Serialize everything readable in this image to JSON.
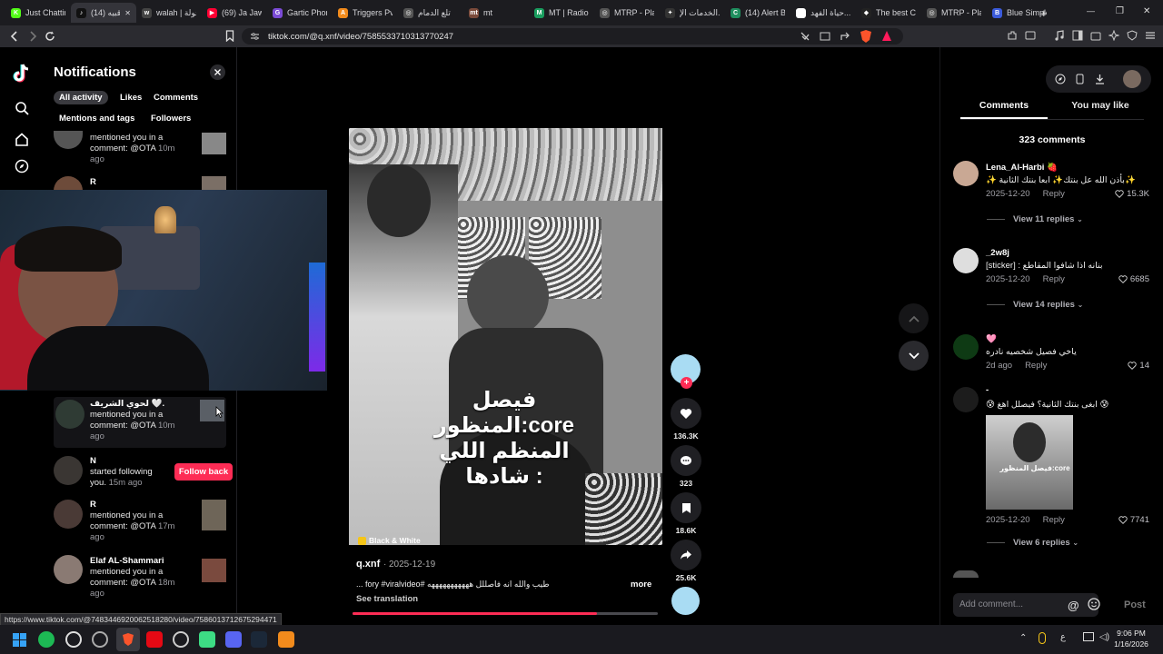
{
  "browser": {
    "tabs": [
      {
        "label": "Just Chattin",
        "favicon": "K",
        "color": "#53fc18"
      },
      {
        "label": "(14) قبيه",
        "favicon": "♪",
        "color": "#111111",
        "active": true
      },
      {
        "label": "walah | جولة",
        "favicon": "w",
        "color": "#444444"
      },
      {
        "label": "(69) Ja Jaw...",
        "favicon": "▶",
        "color": "#ff0033"
      },
      {
        "label": "Gartic Phon...",
        "favicon": "G",
        "color": "#7b4bd6"
      },
      {
        "label": "Triggers Pv...",
        "favicon": "A",
        "color": "#f28b1c"
      },
      {
        "label": "تلع الدمام",
        "favicon": "◎",
        "color": "#555555"
      },
      {
        "label": "mt",
        "favicon": "mt",
        "color": "#7a4a3a"
      },
      {
        "label": "MT | Radio",
        "favicon": "M",
        "color": "#1a9e5f"
      },
      {
        "label": "MTRP - Pla...",
        "favicon": "◎",
        "color": "#555555"
      },
      {
        "label": "الخدمات الإ...",
        "favicon": "✦",
        "color": "#333333"
      },
      {
        "label": "(14) Alert B...",
        "favicon": "C",
        "color": "#1f8f5f"
      },
      {
        "label": "حياة الفهد...",
        "favicon": "G",
        "color": "#ffffff"
      },
      {
        "label": "The best Cl...",
        "favicon": "◆",
        "color": "#222222"
      },
      {
        "label": "MTRP - Pla...",
        "favicon": "◎",
        "color": "#555555"
      },
      {
        "label": "Blue Simple...",
        "favicon": "B",
        "color": "#3b5bdb"
      }
    ],
    "url": "tiktok.com/@q.xnf/video/7585533710313770247",
    "status_url": "https://www.tiktok.com/@7483446920062518280/video/7586013712675294471"
  },
  "notifications": {
    "title": "Notifications",
    "filters": [
      "All activity",
      "Likes",
      "Comments",
      "Mentions and tags",
      "Followers"
    ],
    "items": [
      {
        "name": "",
        "line1": "mentioned you in a",
        "line2": "comment: @OTA",
        "time": "10m",
        "time2": "ago"
      },
      {
        "name": "R",
        "line1": "",
        "line2": "",
        "time": "",
        "time2": ""
      },
      {
        "name": "لحوي الشريف 🤍.",
        "line1": "mentioned you in a",
        "line2": "comment: @OTA",
        "time": "10m",
        "time2": "ago"
      },
      {
        "name": "N",
        "line1": "started following",
        "line2": "you.",
        "time": "15m ago",
        "time2": ""
      },
      {
        "name": "R",
        "line1": "mentioned you in a",
        "line2": "comment: @OTA",
        "time": "17m",
        "time2": "ago"
      },
      {
        "name": "Elaf AL-Shammari",
        "line1": "mentioned you in a",
        "line2": "comment: @OTA",
        "time": "18m",
        "time2": "ago"
      }
    ],
    "follow_back": "Follow back"
  },
  "video": {
    "overlay_line1": "فيصل المنظور:core",
    "overlay_line2": "المنظم اللي شادها :",
    "filter_badge": "Black & White",
    "author": "q.xnf",
    "date": "2025-12-19",
    "caption": "طيب والله انه فاصللل هههههههههههه #fory #viralvideo ...",
    "more": "more",
    "see_translation": "See translation",
    "progress": 0.8
  },
  "actions": {
    "likes": "136.3K",
    "comments": "323",
    "saves": "18.6K",
    "shares": "25.6K"
  },
  "side": {
    "tab_comments": "Comments",
    "tab_like": "You may like",
    "count": "323 comments",
    "add_placeholder": "Add comment...",
    "post": "Post",
    "comments": [
      {
        "name": "Lena_Al-Harbi 🍓",
        "text": "✨بأذن الله عل بنتك✨ ابعا بنتك الثانية ✨",
        "date": "2025-12-20",
        "reply": "Reply",
        "likes": "15.3K",
        "view": "View 11 replies"
      },
      {
        "name": "_2w8j",
        "text": "بنانه اذا شافوا المقاطع : [sticker]",
        "date": "2025-12-20",
        "reply": "Reply",
        "likes": "6685",
        "view": "View 14 replies"
      },
      {
        "name": "🩷",
        "text": "ياخي فصيل شخصيه نادره",
        "date": "2d ago",
        "reply": "Reply",
        "likes": "14",
        "view": ""
      },
      {
        "name": "-",
        "text": "😰 ابغى بنتك الثانية؟ فيصلل اهغ 😰",
        "date": "2025-12-20",
        "reply": "Reply",
        "likes": "7741",
        "view": "View 6 replies",
        "thumb_text": "فيصل المنظور:core"
      }
    ]
  },
  "taskbar": {
    "time": "9:06 PM",
    "date": "1/16/2026",
    "lang": "ع"
  }
}
